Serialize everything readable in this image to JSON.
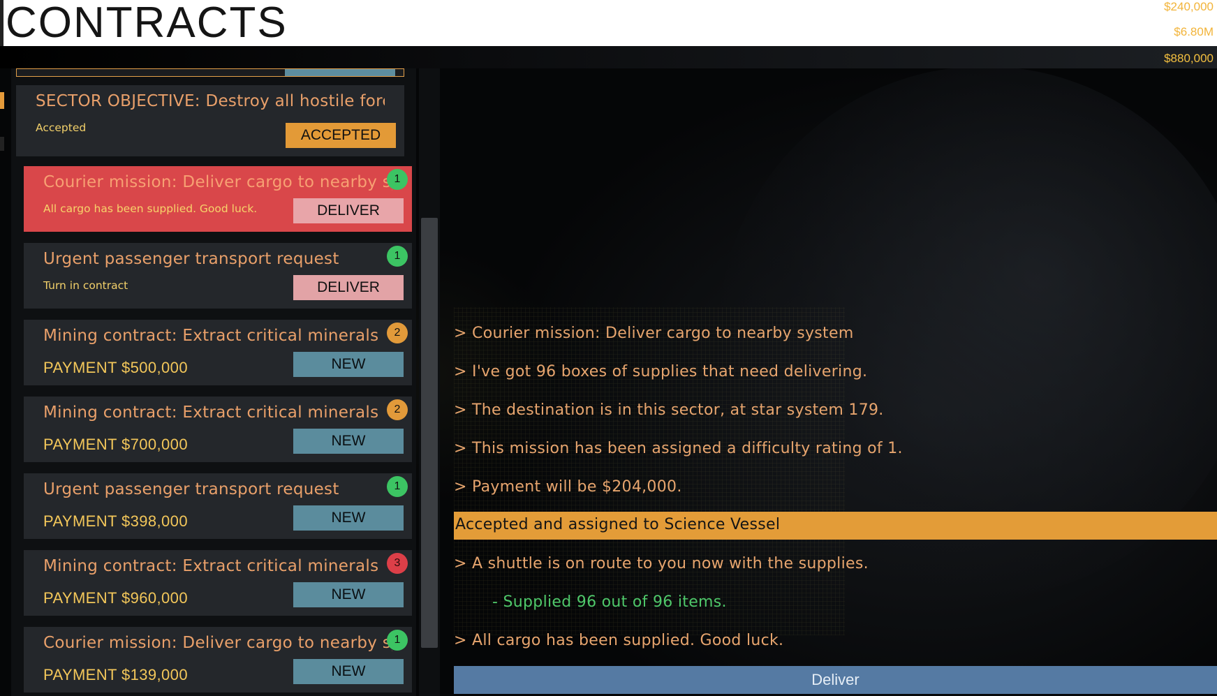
{
  "header": {
    "title": "CONTRACTS",
    "money": [
      "$240,000",
      "$6.80M",
      "$880,000"
    ]
  },
  "contracts": [
    {
      "title": "SECTOR OBJECTIVE: Destroy all hostile forces",
      "sub": "Accepted",
      "button": "ACCEPTED",
      "badge": ""
    },
    {
      "title": "Courier mission: Deliver cargo to nearby system",
      "sub": "All cargo has been supplied. Good luck.",
      "button": "DELIVER",
      "badge": "1"
    },
    {
      "title": "Urgent passenger transport request",
      "sub": "Turn in contract",
      "button": "DELIVER",
      "badge": "1"
    },
    {
      "title": "Mining contract: Extract critical minerals",
      "sub": "PAYMENT  $500,000",
      "button": "NEW",
      "badge": "2"
    },
    {
      "title": "Mining contract: Extract critical minerals",
      "sub": "PAYMENT  $700,000",
      "button": "NEW",
      "badge": "2"
    },
    {
      "title": "Urgent passenger transport request",
      "sub": "PAYMENT  $398,000",
      "button": "NEW",
      "badge": "1"
    },
    {
      "title": "Mining contract: Extract critical minerals",
      "sub": "PAYMENT  $960,000",
      "button": "NEW",
      "badge": "3"
    },
    {
      "title": "Courier mission: Deliver cargo to nearby system",
      "sub": "PAYMENT  $139,000",
      "button": "NEW",
      "badge": "1"
    }
  ],
  "log": {
    "lines": [
      "> Courier mission: Deliver cargo to nearby system",
      "> I've got 96 boxes of supplies that need delivering.",
      "> The destination is in this sector, at star system 179.",
      "> This mission has been assigned a difficulty rating of 1.",
      "> Payment will be $204,000."
    ],
    "highlight": "Accepted and assigned to  Science Vessel",
    "after": "> A shuttle is on route to you now with the supplies.",
    "supplied": "- Supplied 96 out of 96 items.",
    "final": "> All cargo has been supplied. Good luck."
  },
  "deliver_button": "Deliver"
}
